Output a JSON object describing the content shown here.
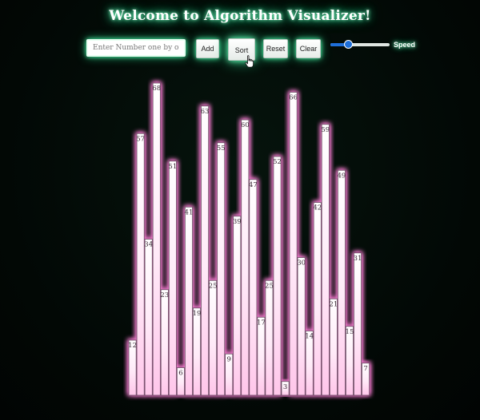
{
  "header": {
    "title": "Welcome to Algorithm Visualizer!"
  },
  "controls": {
    "input_placeholder": "Enter Number one by one",
    "input_value": "",
    "add_label": "Add",
    "sort_label": "Sort",
    "reset_label": "Reset",
    "clear_label": "Clear",
    "speed_label": "Speed",
    "speed_value": 0.3
  },
  "colors": {
    "bar_glow": "#ff7fd8",
    "bar_top": "#ffffff",
    "bar_bottom": "#ffc8ec",
    "title_glow": "#3fe09a",
    "slider_accent": "#1e6fd9"
  },
  "chart_data": {
    "type": "bar",
    "values": [
      12,
      57,
      34,
      68,
      23,
      51,
      6,
      41,
      19,
      63,
      25,
      55,
      9,
      39,
      60,
      47,
      17,
      25,
      52,
      3,
      66,
      30,
      14,
      42,
      59,
      21,
      49,
      15,
      31,
      7
    ]
  }
}
